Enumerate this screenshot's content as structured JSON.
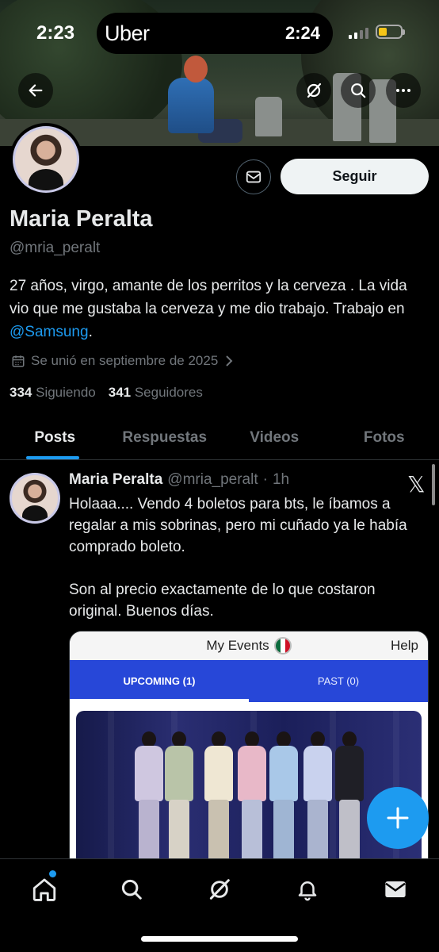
{
  "status_bar": {
    "time": "2:23",
    "island_app": "Uber",
    "island_time": "2:24",
    "battery_level": 0.4
  },
  "profile": {
    "name": "Maria Peralta",
    "handle": "@mria_peralt",
    "follow_label": "Seguir",
    "bio_text": "27 años, virgo, amante de los perritos y la cerveza . La vida vio que me gustaba la cerveza y me dio trabajo. Trabajo en ",
    "bio_mention": "@Samsung",
    "bio_end": ".",
    "joined": "Se unió en septiembre de 2025",
    "following_count": "334",
    "following_label": "Siguiendo",
    "followers_count": "341",
    "followers_label": "Seguidores"
  },
  "tabs": [
    {
      "label": "Posts",
      "active": true
    },
    {
      "label": "Respuestas",
      "active": false
    },
    {
      "label": "Videos",
      "active": false
    },
    {
      "label": "Fotos",
      "active": false
    }
  ],
  "post": {
    "author": "Maria Peralta",
    "handle": "@mria_peralt",
    "time": "1h",
    "text": "Holaaa.... Vendo 4 boletos para bts, le íbamos a regalar a mis sobrinas, pero mi cuñado ya le había comprado boleto.\n\nSon al precio exactamente de lo que costaron original. Buenos días.",
    "media": {
      "header": "My Events",
      "help": "Help",
      "tabs": [
        {
          "label": "UPCOMING (1)",
          "active": true
        },
        {
          "label": "PAST (0)",
          "active": false
        }
      ]
    }
  },
  "icons": {
    "back": "back-arrow-icon",
    "grok": "grok-icon",
    "search": "search-icon",
    "more": "more-icon",
    "message": "envelope-icon",
    "calendar": "calendar-icon",
    "compose": "plus-icon"
  },
  "colors": {
    "accent": "#1d9bf0",
    "background": "#000000",
    "muted": "#71767b",
    "ticket_blue": "#2747d8"
  }
}
